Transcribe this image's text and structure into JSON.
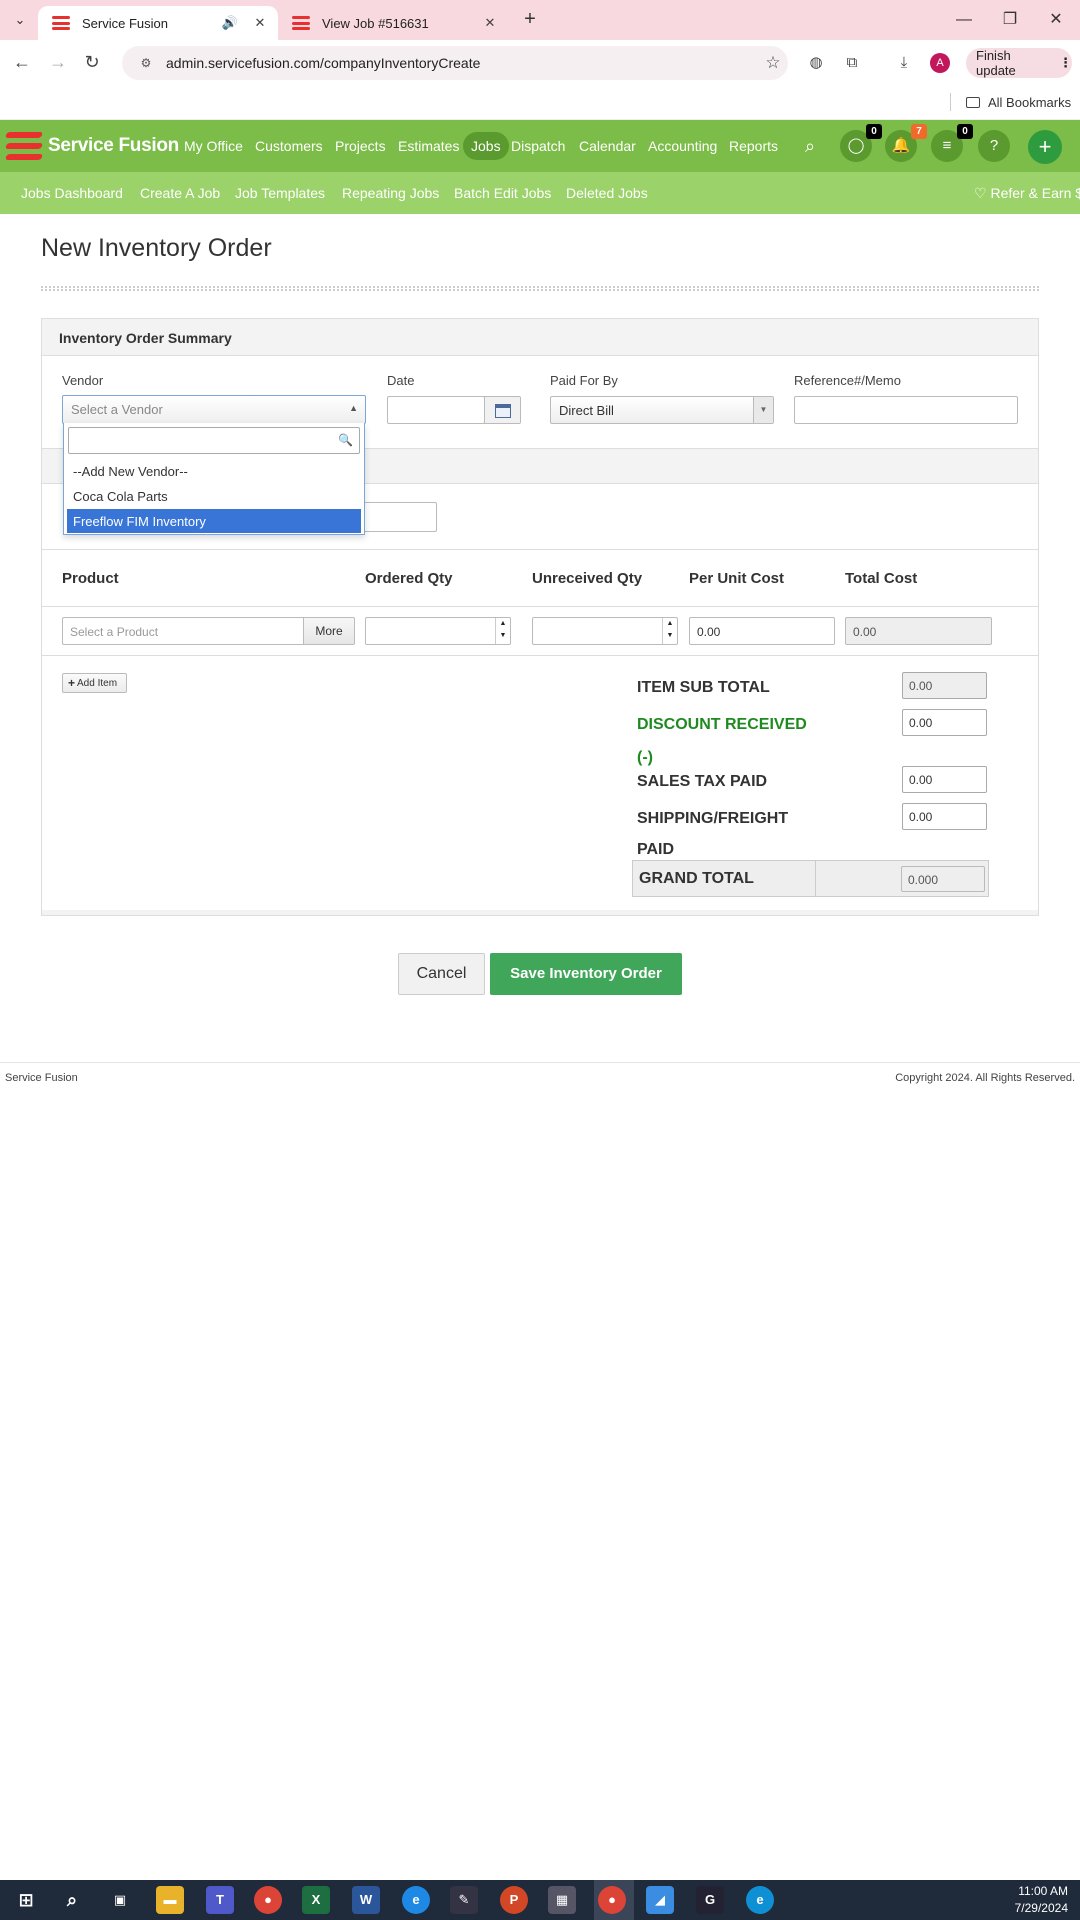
{
  "browser": {
    "tabs": [
      {
        "title": "Service Fusion",
        "active": true
      },
      {
        "title": "View Job #516631",
        "active": false
      }
    ],
    "url": "admin.servicefusion.com/companyInventoryCreate",
    "finish_update": "Finish update",
    "avatar_letter": "A",
    "bookmarks_label": "All Bookmarks"
  },
  "app": {
    "logo_text": "Service Fusion",
    "nav": [
      "My Office",
      "Customers",
      "Projects",
      "Estimates",
      "Jobs",
      "Dispatch",
      "Calendar",
      "Accounting",
      "Reports"
    ],
    "active_nav": "Jobs",
    "badges": {
      "chat": "0",
      "notifications": "7",
      "tasks": "0"
    },
    "help": "?",
    "plus": "+",
    "subnav": [
      "Jobs Dashboard",
      "Create A Job",
      "Job Templates",
      "Repeating Jobs",
      "Batch Edit Jobs",
      "Deleted Jobs"
    ],
    "refer": "Refer & Earn $"
  },
  "page": {
    "title": "New Inventory Order",
    "summary_heading": "Inventory Order Summary",
    "vendor": {
      "label": "Vendor",
      "placeholder": "Select a Vendor"
    },
    "date": {
      "label": "Date",
      "value": ""
    },
    "paid_for_by": {
      "label": "Paid For By",
      "value": "Direct Bill"
    },
    "reference": {
      "label": "Reference#/Memo",
      "value": ""
    },
    "vendor_dropdown": {
      "search_value": "",
      "options": [
        "--Add New Vendor--",
        "Coca Cola Parts",
        "Freeflow FIM Inventory"
      ],
      "highlighted": "Freeflow FIM Inventory"
    },
    "columns": [
      "Product",
      "Ordered Qty",
      "Unreceived Qty",
      "Per Unit Cost",
      "Total Cost"
    ],
    "line_item": {
      "product_placeholder": "Select a Product",
      "more": "More",
      "ordered_qty": "",
      "unreceived_qty": "",
      "per_unit_cost": "0.00",
      "total_cost": "0.00"
    },
    "add_item": "Add Item",
    "totals": {
      "item_sub_total_label": "ITEM SUB TOTAL",
      "item_sub_total": "0.00",
      "discount_label_1": "DISCOUNT RECEIVED",
      "discount_label_2": "(-)",
      "discount": "0.00",
      "sales_tax_label": "SALES TAX PAID",
      "sales_tax": "0.00",
      "shipping_label_1": "SHIPPING/FREIGHT",
      "shipping_label_2": "PAID",
      "shipping": "0.00",
      "grand_total_label": "GRAND TOTAL",
      "grand_total": "0.000"
    },
    "cancel": "Cancel",
    "save": "Save Inventory Order"
  },
  "footer": {
    "left": "Service Fusion",
    "right": "Copyright 2024. All Rights Reserved."
  },
  "taskbar": {
    "time": "11:00 AM",
    "date": "7/29/2024"
  },
  "colors": {
    "nav_green": "#7cbc48",
    "subnav_green": "#9bd26a",
    "save_green": "#3fa65a",
    "highlight_blue": "#3875d7",
    "discount_green": "#1f8a1f"
  }
}
